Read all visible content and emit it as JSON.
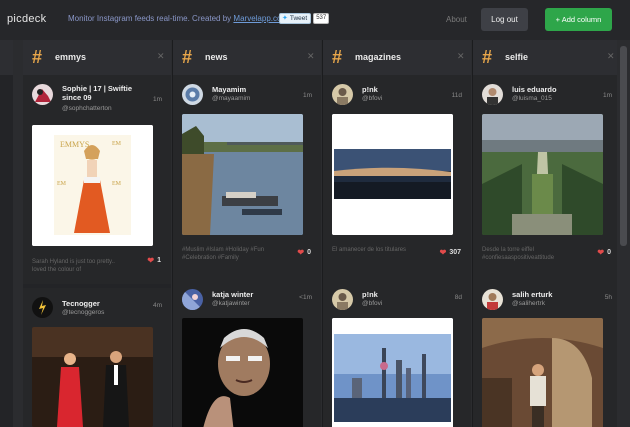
{
  "app": {
    "logo": "picdeck",
    "tagline": "Monitor Instagram feeds real-time. Created by",
    "tagline_link": "Marvelapp.com",
    "tweet_label": "Tweet",
    "tweet_count": "537",
    "about": "About",
    "logout": "Log out",
    "add_column": "+ Add column"
  },
  "columns": [
    {
      "title": "emmys",
      "posts": [
        {
          "user": "Sophie | 17 | Swiftie since 09",
          "handle": "@sophchatterton",
          "age": "1m",
          "caption": "Sarah Hyland is just too pretty.. loved the colour of",
          "likes": "1"
        },
        {
          "user": "Tecnogger",
          "handle": "@tecnoggeros",
          "age": "4m"
        }
      ]
    },
    {
      "title": "news",
      "posts": [
        {
          "user": "Mayamim",
          "handle": "@mayaamim",
          "age": "1m",
          "caption": "#Muslim #Islam #Holiday #Fun #Celebration #Family",
          "likes": "0"
        },
        {
          "user": "katja winter",
          "handle": "@katjawinter",
          "age": "<1m"
        }
      ]
    },
    {
      "title": "magazines",
      "posts": [
        {
          "user": "p!nk",
          "handle": "@bfovi",
          "age": "11d",
          "caption": "El amanecer de los titulares",
          "likes": "307"
        },
        {
          "user": "p!nk",
          "handle": "@bfovi",
          "age": "8d"
        }
      ]
    },
    {
      "title": "selfie",
      "posts": [
        {
          "user": "luis eduardo",
          "handle": "@luisma_015",
          "age": "1m",
          "caption": "Desde la torre eiffel #confiesaaspositiveattitude",
          "likes": "0"
        },
        {
          "user": "salih erturk",
          "handle": "@salihertrk",
          "age": "5h"
        }
      ]
    }
  ],
  "colors": {
    "accent_green": "#2ea64a",
    "hash_orange": "#e7a64b",
    "heart_red": "#e24b4b",
    "topbar": "#26272a"
  }
}
